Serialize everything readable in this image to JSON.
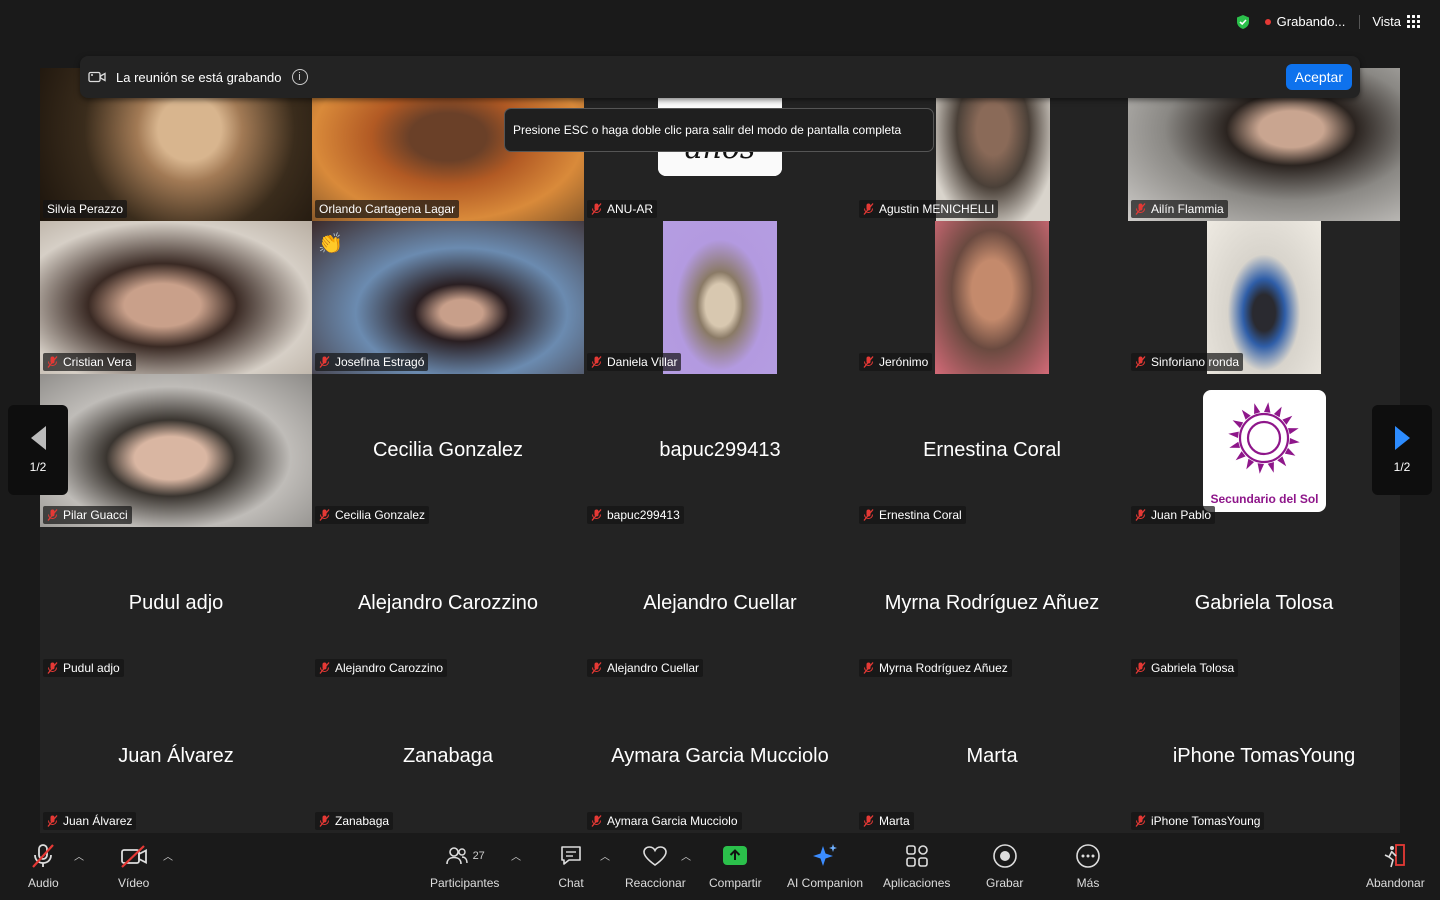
{
  "status": {
    "recording_label": "Grabando...",
    "view_label": "Vista"
  },
  "banner": {
    "text": "La reunión se está grabando",
    "accept_label": "Aceptar",
    "tooltip": "Presione ESC o haga doble clic para salir del modo de pantalla completa"
  },
  "pager": {
    "left_label": "1/2",
    "right_label": "1/2"
  },
  "participants": [
    {
      "name": "Silvia Perazzo",
      "muted": false,
      "video": "silvia"
    },
    {
      "name": "Orlando Cartagena Lagar",
      "muted": false,
      "video": "orlando"
    },
    {
      "name": "ANU-AR",
      "muted": true,
      "video": "anu",
      "card_text": "años"
    },
    {
      "name": "Agustin MENICHELLI",
      "muted": true,
      "video": "agustin"
    },
    {
      "name": "Ailín Flammia",
      "muted": true,
      "video": "ailin"
    },
    {
      "name": "Cristian Vera",
      "muted": true,
      "video": "cristian"
    },
    {
      "name": "Josefina Estragó",
      "muted": true,
      "video": "josefina"
    },
    {
      "name": "Daniela Villar",
      "muted": true,
      "video": "daniela"
    },
    {
      "name": "Jerónimo",
      "muted": true,
      "video": "jeronimo"
    },
    {
      "name": "Sinforiano ronda",
      "muted": true,
      "video": "sinfo"
    },
    {
      "name": "Pilar Guacci",
      "muted": true,
      "video": "pilar"
    },
    {
      "name": "Cecilia Gonzalez",
      "muted": true
    },
    {
      "name": "bapuc299413",
      "muted": true
    },
    {
      "name": "Ernestina Coral",
      "muted": true
    },
    {
      "name": "Juan Pablo",
      "muted": true,
      "logo_text": "Secundario del Sol"
    },
    {
      "name": "Pudul adjo",
      "muted": true
    },
    {
      "name": "Alejandro Carozzino",
      "muted": true
    },
    {
      "name": "Alejandro Cuellar",
      "muted": true
    },
    {
      "name": "Myrna Rodríguez Añuez",
      "muted": true
    },
    {
      "name": "Gabriela Tolosa",
      "muted": true
    },
    {
      "name": "Juan Álvarez",
      "muted": true
    },
    {
      "name": "Zanabaga",
      "muted": true
    },
    {
      "name": "Aymara Garcia Mucciolo",
      "muted": true
    },
    {
      "name": "Marta",
      "muted": true
    },
    {
      "name": "iPhone TomasYoung",
      "muted": true
    }
  ],
  "toolbar": {
    "audio": "Audio",
    "video": "Vídeo",
    "participants": "Participantes",
    "participants_count": "27",
    "chat": "Chat",
    "react": "Reaccionar",
    "share": "Compartir",
    "ai": "AI Companion",
    "apps": "Aplicaciones",
    "record": "Grabar",
    "more": "Más",
    "leave": "Abandonar"
  },
  "colors": {
    "accent": "#0e72ed",
    "active_speaker": "#2bc04b",
    "share_green": "#2bc04b",
    "muted_red": "#e53935"
  }
}
